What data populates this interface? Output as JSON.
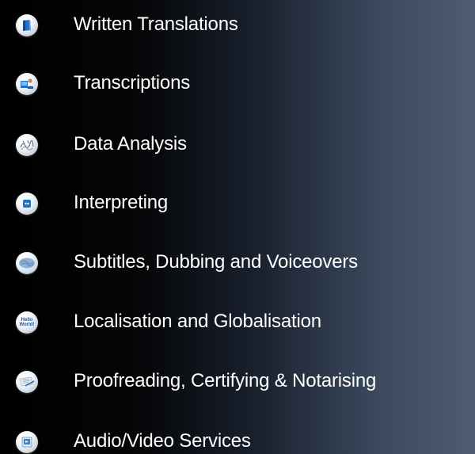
{
  "menu": {
    "items": [
      {
        "label": "Written Translations",
        "icon": "book-icon"
      },
      {
        "label": "Transcriptions",
        "icon": "transcription-icon"
      },
      {
        "label": "Data Analysis",
        "icon": "analysis-icon"
      },
      {
        "label": "Interpreting",
        "icon": "interpreting-icon"
      },
      {
        "label": "Subtitles, Dubbing and Voiceovers",
        "icon": "brain-icon"
      },
      {
        "label": "Localisation and Globalisation",
        "icon": "hello-world-icon",
        "icon_text": "Hello World!"
      },
      {
        "label": "Proofreading, Certifying & Notarising",
        "icon": "document-pen-icon"
      },
      {
        "label": "Audio/Video Services",
        "icon": "media-icon"
      }
    ]
  },
  "colors": {
    "background_left": "#000000",
    "background_right": "#4e5d72",
    "text": "#ffffff",
    "accent_blue": "#1d6fbf"
  }
}
